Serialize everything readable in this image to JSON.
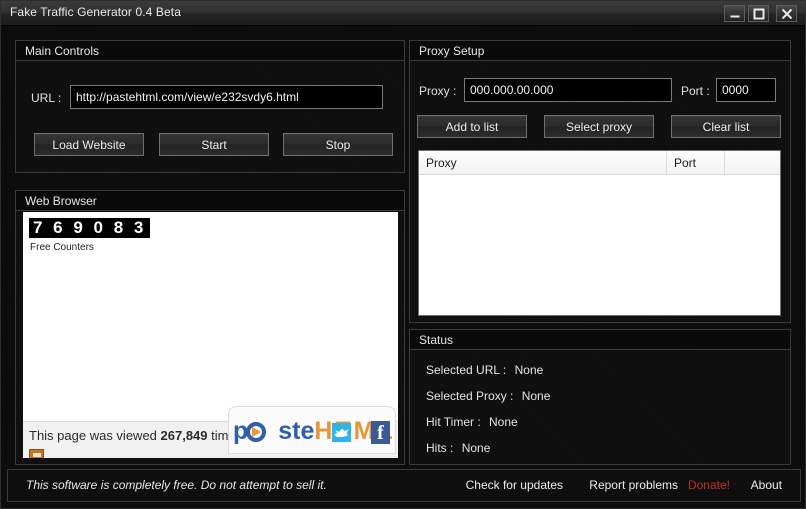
{
  "window": {
    "title": "Fake Traffic Generator 0.4 Beta",
    "controls": {
      "minimize": "minimize-icon",
      "maximize": "maximize-icon",
      "close": "close-icon"
    }
  },
  "main_controls": {
    "group_title": "Main Controls",
    "url_label": "URL :",
    "url_value": "http://pastehtml.com/view/e232svdy6.html",
    "url_placeholder": "http://",
    "buttons": {
      "load": "Load Website",
      "start": "Start",
      "stop": "Stop"
    }
  },
  "proxy_setup": {
    "group_title": "Proxy Setup",
    "proxy_label": "Proxy :",
    "proxy_value": "000.000.00.000",
    "proxy_placeholder": "000.000.00.000",
    "port_label": "Port :",
    "port_value": "0000",
    "port_placeholder": "0000",
    "buttons": {
      "add": "Add to list",
      "select": "Select proxy",
      "clear": "Clear list"
    },
    "list": {
      "columns": [
        "Proxy",
        "Port",
        ""
      ],
      "rows": []
    }
  },
  "web_browser": {
    "group_title": "Web Browser",
    "page": {
      "counter_digits": "7 6 9 0 8 3",
      "counter_caption": "Free Counters",
      "views_prefix": "This page was viewed ",
      "views_count": "267,849",
      "views_suffix": " times",
      "logo_paste": "p",
      "logo_paste_rest": "ste",
      "logo_html": "H T M L",
      "logo_brand": "pasteHTML",
      "twitter_icon": "twitter-icon",
      "facebook_icon": "facebook-icon"
    }
  },
  "status": {
    "group_title": "Status",
    "rows": [
      {
        "label": "Selected URL :",
        "value": "None"
      },
      {
        "label": "Selected Proxy :",
        "value": "None"
      },
      {
        "label": "Hit Timer :",
        "value": "None"
      },
      {
        "label": "Hits :",
        "value": "None"
      }
    ]
  },
  "footer": {
    "disclaimer": "This software is completely free. Do not attempt to sell it.",
    "links": {
      "updates": "Check for updates",
      "report": "Report problems",
      "donate": "Donate!",
      "about": "About"
    },
    "donate_color": "#c0302a"
  }
}
